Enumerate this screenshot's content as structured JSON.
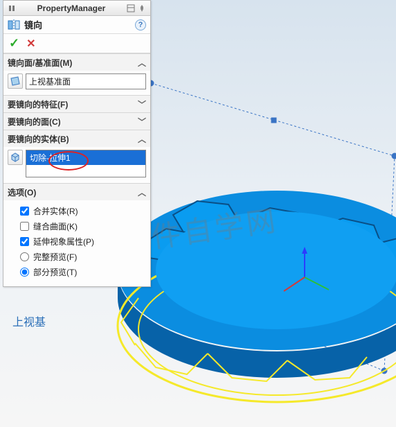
{
  "header": {
    "title": "PropertyManager"
  },
  "feature": {
    "label": "镜向",
    "help_tooltip": "?"
  },
  "confirm": {
    "ok": "✓",
    "cancel": "✕"
  },
  "sections": {
    "mirror_plane": {
      "title": "镜向面/基准面(M)",
      "value": "上视基准面",
      "expanded": true
    },
    "features_to_mirror": {
      "title": "要镜向的特征(F)",
      "expanded": false
    },
    "faces_to_mirror": {
      "title": "要镜向的面(C)",
      "expanded": false
    },
    "bodies_to_mirror": {
      "title": "要镜向的实体(B)",
      "selected_item": "切除-拉伸1",
      "expanded": true
    },
    "options": {
      "title": "选项(O)",
      "merge_bodies": {
        "label": "合并实体(R)",
        "checked": true
      },
      "knit_surfaces": {
        "label": "缝合曲面(K)",
        "checked": false
      },
      "extend_visual": {
        "label": "延伸视象属性(P)",
        "checked": true
      },
      "full_preview": {
        "label": "完整预览(F)",
        "selected": false
      },
      "partial_preview": {
        "label": "部分预览(T)",
        "selected": true
      }
    }
  },
  "viewport": {
    "plane_label": "上视基"
  },
  "watermark": "软件自学网"
}
